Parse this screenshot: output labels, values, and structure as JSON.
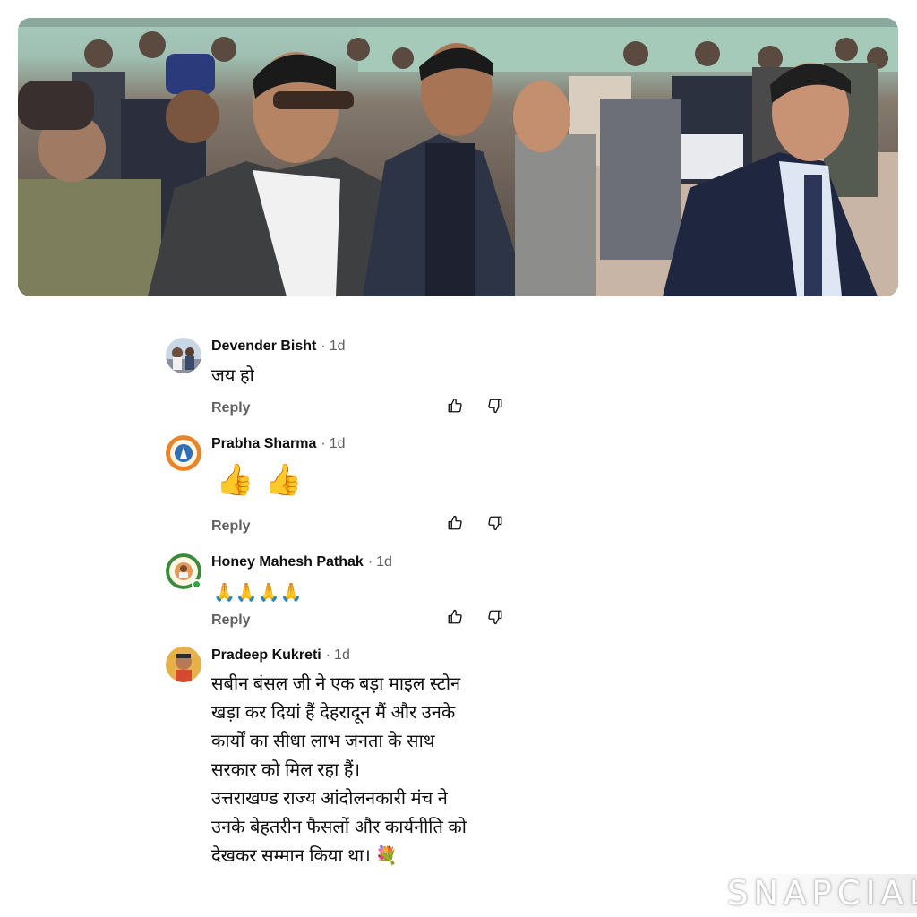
{
  "comments": [
    {
      "author": "Devender Bisht",
      "time": "1d",
      "separator": "·",
      "text": "जय हो",
      "reply": "Reply",
      "avatar": "profile-photo"
    },
    {
      "author": "Prabha Sharma",
      "time": "1d",
      "separator": "·",
      "text": "👍👍",
      "reply": "Reply",
      "avatar": "emblem-badge"
    },
    {
      "author": "Honey Mahesh Pathak",
      "time": "1d",
      "separator": "·",
      "text": "🙏🙏🙏🙏",
      "reply": "Reply",
      "avatar": "emblem-badge",
      "online": true
    },
    {
      "author": "Pradeep Kukreti",
      "time": "1d",
      "separator": "·",
      "reply": "Reply",
      "avatar": "profile-photo",
      "lines": [
        "सबीन बंसल जी ने एक बड़ा माइल स्टोन",
        "खड़ा कर दियां हैं देहरादून मैं और उनके",
        "कार्यों का सीधा लाभ जनता के साथ",
        "सरकार को मिल रहा हैं।",
        "उत्तराखण्ड राज्य आंदोलनकारी मंच ने",
        "उनके बेहतरीन फैसलों और कार्यनीति को",
        "देखकर सम्मान किया था। 💐"
      ]
    }
  ],
  "icons": {
    "like": "thumbs-up-icon",
    "dislike": "thumbs-down-icon"
  },
  "watermark": "SNAPCIAL",
  "colors": {
    "secondary_text": "#606060",
    "primary_text": "#0f0f0f",
    "online": "#2ba640"
  }
}
